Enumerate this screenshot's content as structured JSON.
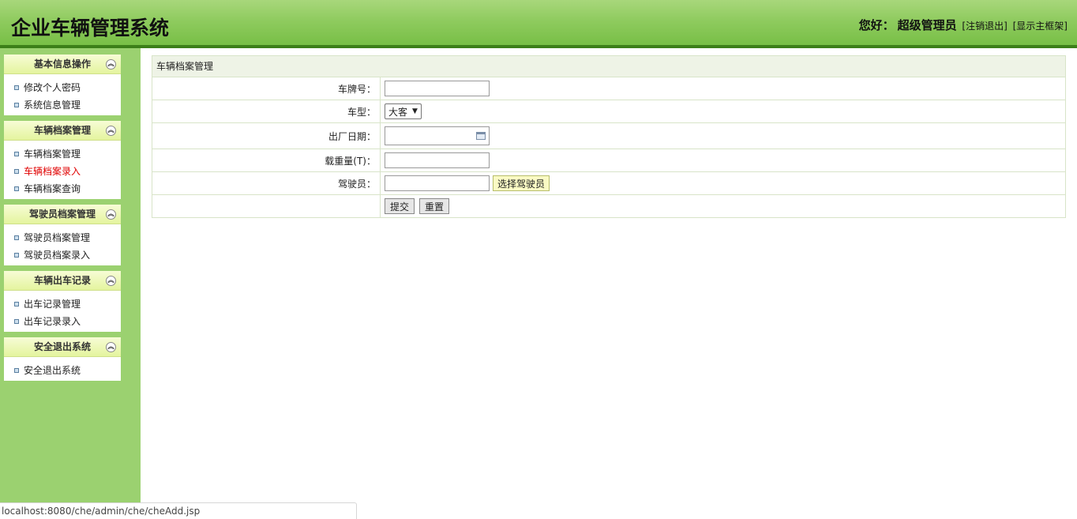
{
  "header": {
    "title": "企业车辆管理系统",
    "greeting": "您好：",
    "username": "超级管理员",
    "logout_link": "[注销退出]",
    "frame_link": "[显示主框架]"
  },
  "sidebar": {
    "sections": [
      {
        "title": "基本信息操作",
        "items": [
          "修改个人密码",
          "系统信息管理"
        ]
      },
      {
        "title": "车辆档案管理",
        "items": [
          "车辆档案管理",
          "车辆档案录入",
          "车辆档案查询"
        ],
        "active_index": 1
      },
      {
        "title": "驾驶员档案管理",
        "items": [
          "驾驶员档案管理",
          "驾驶员档案录入"
        ]
      },
      {
        "title": "车辆出车记录",
        "items": [
          "出车记录管理",
          "出车记录录入"
        ]
      },
      {
        "title": "安全退出系统",
        "items": [
          "安全退出系统"
        ]
      }
    ],
    "collapse_glyph": "»",
    "active_color": "#e00000"
  },
  "form": {
    "panel_title": "车辆档案管理",
    "fields": {
      "plate_label": "车牌号：",
      "plate_value": "",
      "type_label": "车型：",
      "type_selected": "大客",
      "date_label": "出厂日期：",
      "date_value": "",
      "load_label": "载重量(T)：",
      "load_value": "",
      "driver_label": "驾驶员：",
      "driver_value": "",
      "choose_driver_button": "选择驾驶员"
    },
    "submit_button": "提交",
    "reset_button": "重置"
  },
  "statusbar": {
    "url": "localhost:8080/che/admin/che/cheAdd.jsp"
  }
}
